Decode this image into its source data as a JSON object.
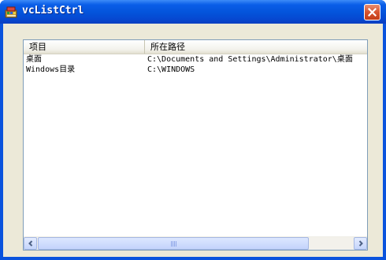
{
  "window": {
    "title": "vcListCtrl"
  },
  "list": {
    "columns": [
      "项目",
      "所在路径"
    ],
    "rows": [
      {
        "item": "桌面",
        "path": "C:\\Documents and Settings\\Administrator\\桌面"
      },
      {
        "item": "Windows目录",
        "path": "C:\\WINDOWS"
      }
    ]
  },
  "colors": {
    "titlebar": "#0353da",
    "client": "#ece9d8",
    "close": "#d7542f"
  },
  "icons": {
    "app": "app-icon",
    "close": "close-icon",
    "scroll_left": "arrow-left-icon",
    "scroll_right": "arrow-right-icon"
  },
  "scrollbar": {
    "visible_fraction": 0.86
  }
}
